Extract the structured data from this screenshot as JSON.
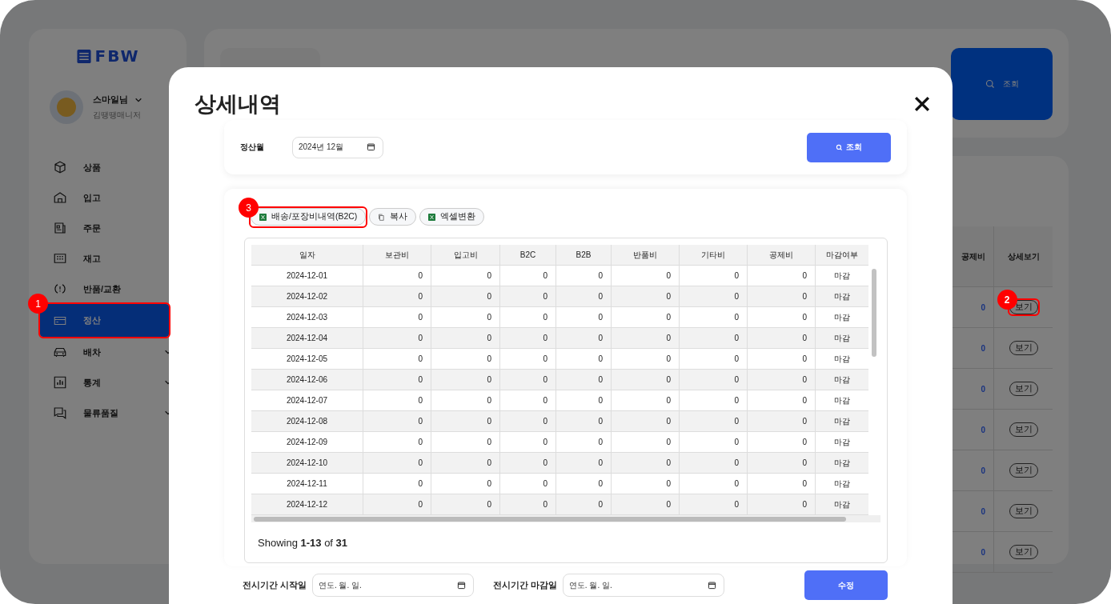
{
  "logo": {
    "text": "FBW"
  },
  "user": {
    "name": "스마일님",
    "role": "김땡땡매니저"
  },
  "sidebar": {
    "items": [
      {
        "label": "상품",
        "selected": false,
        "expandable": false
      },
      {
        "label": "입고",
        "selected": false,
        "expandable": false
      },
      {
        "label": "주문",
        "selected": false,
        "expandable": false
      },
      {
        "label": "재고",
        "selected": false,
        "expandable": false
      },
      {
        "label": "반품/교환",
        "selected": false,
        "expandable": false
      },
      {
        "label": "정산",
        "selected": true,
        "expandable": false,
        "callout": "1"
      },
      {
        "label": "배차",
        "selected": false,
        "expandable": true
      },
      {
        "label": "통계",
        "selected": false,
        "expandable": true
      },
      {
        "label": "물류품질",
        "selected": false,
        "expandable": true
      }
    ]
  },
  "background": {
    "search_button": "조회",
    "table": {
      "columns": [
        "공제비",
        "상세보기"
      ],
      "rows": [
        {
          "value": "0",
          "action": "보기",
          "callout": "2"
        },
        {
          "value": "0",
          "action": "보기"
        },
        {
          "value": "0",
          "action": "보기"
        },
        {
          "value": "0",
          "action": "보기"
        },
        {
          "value": "0",
          "action": "보기"
        },
        {
          "value": "0",
          "action": "보기"
        },
        {
          "value": "0",
          "action": "보기"
        }
      ]
    }
  },
  "modal": {
    "title": "상세내역",
    "filter": {
      "label": "정산월",
      "value": "2024년 12월",
      "button": "조회"
    },
    "toolbar": [
      {
        "label": "배송/포장비내역(B2C)",
        "kind": "excel",
        "callout": "3"
      },
      {
        "label": "복사",
        "kind": "copy"
      },
      {
        "label": "엑셀변환",
        "kind": "excel"
      }
    ],
    "table": {
      "columns": [
        "일자",
        "보관비",
        "입고비",
        "B2C",
        "B2B",
        "반품비",
        "기타비",
        "공제비",
        "마감여부"
      ],
      "rows": [
        [
          "2024-12-01",
          "0",
          "0",
          "0",
          "0",
          "0",
          "0",
          "0",
          "마감"
        ],
        [
          "2024-12-02",
          "0",
          "0",
          "0",
          "0",
          "0",
          "0",
          "0",
          "마감"
        ],
        [
          "2024-12-03",
          "0",
          "0",
          "0",
          "0",
          "0",
          "0",
          "0",
          "마감"
        ],
        [
          "2024-12-04",
          "0",
          "0",
          "0",
          "0",
          "0",
          "0",
          "0",
          "마감"
        ],
        [
          "2024-12-05",
          "0",
          "0",
          "0",
          "0",
          "0",
          "0",
          "0",
          "마감"
        ],
        [
          "2024-12-06",
          "0",
          "0",
          "0",
          "0",
          "0",
          "0",
          "0",
          "마감"
        ],
        [
          "2024-12-07",
          "0",
          "0",
          "0",
          "0",
          "0",
          "0",
          "0",
          "마감"
        ],
        [
          "2024-12-08",
          "0",
          "0",
          "0",
          "0",
          "0",
          "0",
          "0",
          "마감"
        ],
        [
          "2024-12-09",
          "0",
          "0",
          "0",
          "0",
          "0",
          "0",
          "0",
          "마감"
        ],
        [
          "2024-12-10",
          "0",
          "0",
          "0",
          "0",
          "0",
          "0",
          "0",
          "마감"
        ],
        [
          "2024-12-11",
          "0",
          "0",
          "0",
          "0",
          "0",
          "0",
          "0",
          "마감"
        ],
        [
          "2024-12-12",
          "0",
          "0",
          "0",
          "0",
          "0",
          "0",
          "0",
          "마감"
        ]
      ]
    },
    "summary": "Showing **1-13** of **31**",
    "period": [
      {
        "label": "전시기간 시작일",
        "placeholder": "연도. 월. 일."
      },
      {
        "label": "전시기간 마감일",
        "placeholder": "연도. 월. 일."
      }
    ],
    "save_button": "수정"
  }
}
